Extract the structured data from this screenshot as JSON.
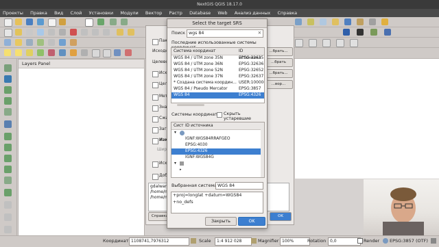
{
  "window": {
    "title": "NextGIS QGIS 18.17.0"
  },
  "menu": [
    "Проекты",
    "Правка",
    "Вид",
    "Слой",
    "Установки",
    "Модули",
    "Вектор",
    "Растр",
    "Database",
    "Web",
    "Анализ данных",
    "Справка"
  ],
  "layers_panel": {
    "title": "Layers Panel"
  },
  "bg_dialog": {
    "btn_label": "...брать...",
    "btn_label2": "...брать",
    "btn_label3": "...брать...",
    "btn_label4": "...вор...",
    "options": [
      "Пакетный режим",
      "Исходный",
      "Целевой",
      "Исходный",
      "Целевой",
      "Метод",
      "Значения",
      "Сжатие",
      "Загрузить",
      "Изменить",
      "Исходный",
      "Добавить"
    ],
    "width_label": "Шири",
    "command": [
      "gdalwarp ...",
      "/home/nad",
      "/home/nad"
    ],
    "help_btn": "Справка",
    "ok_btn": "OK"
  },
  "srs_dialog": {
    "title": "Select the target SRS",
    "search_label": "Поиск",
    "search_value": "wgs 84",
    "recent_label": "Последние использованные системы координат",
    "recent_headers": [
      "Система координат",
      "ID источника"
    ],
    "recent_rows": [
      {
        "name": "WGS 84 / UTM zone 35N",
        "id": "EPSG:32635"
      },
      {
        "name": "WGS 84 / UTM zone 36N",
        "id": "EPSG:32636"
      },
      {
        "name": "WGS 84 / UTM zone 52N",
        "id": "EPSG:32652"
      },
      {
        "name": "WGS 84 / UTM zone 37N",
        "id": "EPSG:32637"
      },
      {
        "name": "* Создана система координ...",
        "id": "USER:100006"
      },
      {
        "name": "WGS 84 / Pseudo Mercator",
        "id": "EPSG:3857"
      },
      {
        "name": "WGS 84",
        "id": "EPSG:4326",
        "selected": true
      }
    ],
    "systems_label": "Системы координат",
    "hide_deprecated": "Скрыть устаревшие",
    "tree_headers": [
      "Сист",
      "ID источника"
    ],
    "tree_rows": [
      {
        "text": "IGNF:WGS84RRAFGEO"
      },
      {
        "text": "EPSG:4030"
      },
      {
        "text": "EPSG:4326",
        "selected": true
      },
      {
        "text": "IGNF:WGS84G"
      }
    ],
    "selected_label": "Выбранная система:",
    "selected_value": "WGS 84",
    "proj_string": "+proj=longlat +datum=WGS84 +no_defs",
    "close_btn": "Закрыть",
    "ok_btn": "OK"
  },
  "statusbar": {
    "coords_label": "Координаты",
    "coords_value": "1108741,7976312",
    "scale_label": "Scale",
    "scale_value": "1:4 912 028",
    "magnifier_label": "Magnifier",
    "magnifier_value": "100%",
    "rotation_label": "Rotation",
    "rotation_value": "0,0",
    "render_label": "Render",
    "crs_label": "EPSG:3857 (OTF)"
  },
  "colors": {
    "accent": "#3d7fd0",
    "menubar": "#4a4a4a"
  }
}
